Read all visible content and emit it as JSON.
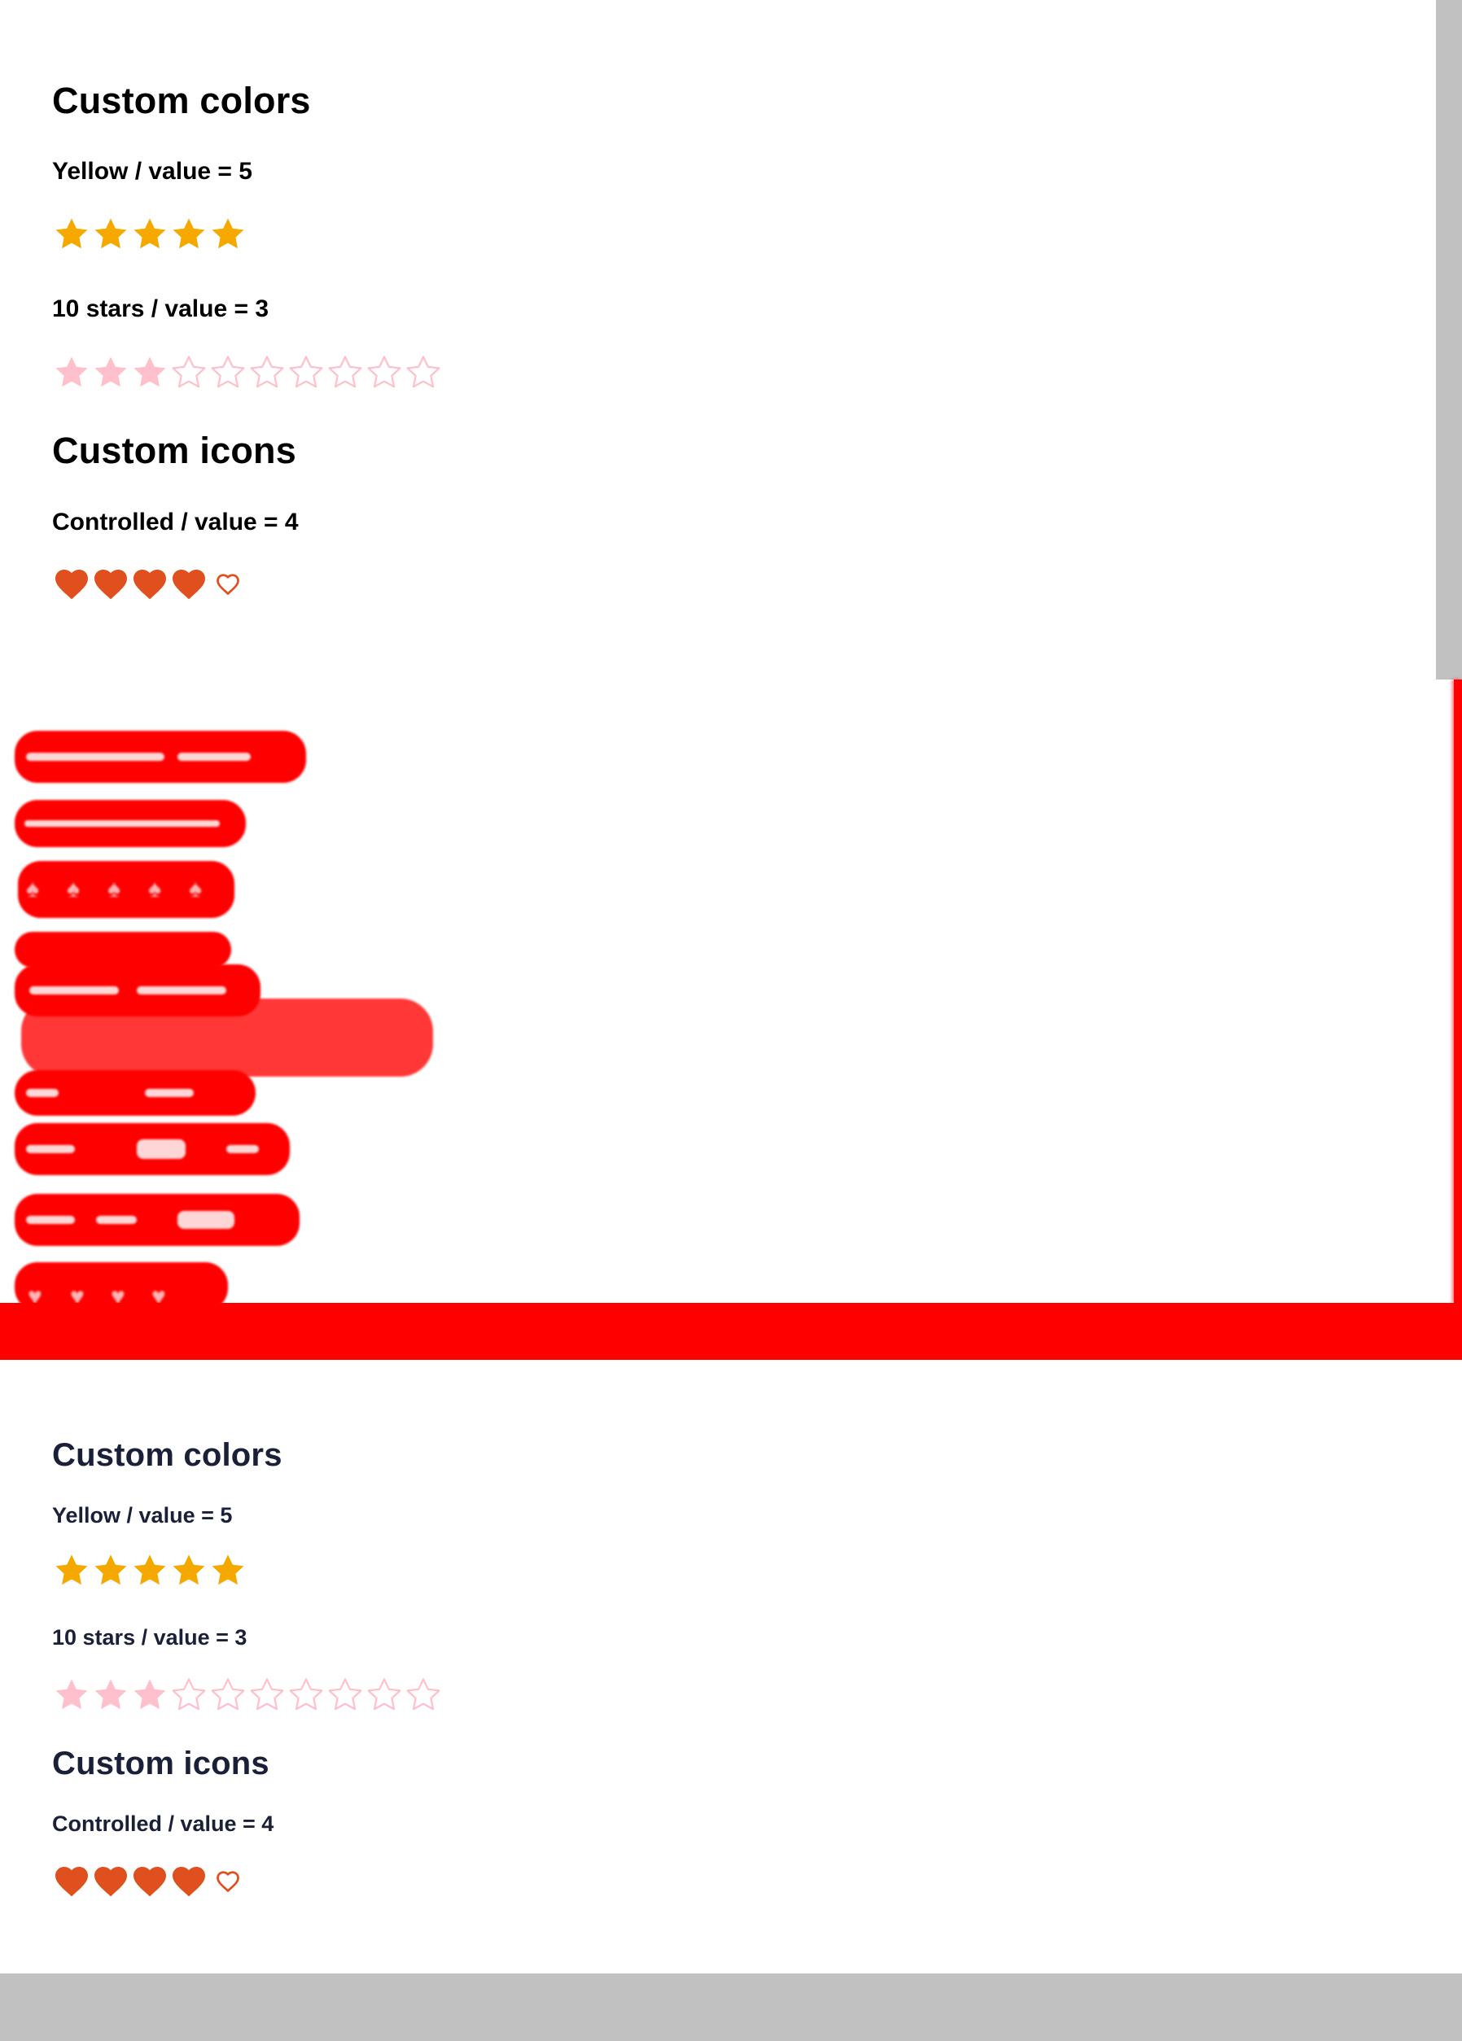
{
  "colors": {
    "yellow": "#f5a800",
    "pink": "#ffc0cb",
    "heart": "#e0501e",
    "diff_red": "#ff0000",
    "scrollbar": "#c1c1c1",
    "heading_top": "#000000",
    "heading_bottom": "#1a2038"
  },
  "icons": {
    "star": "star-icon",
    "star_outline": "star-outline-icon",
    "heart": "heart-icon",
    "heart_outline": "heart-outline-icon"
  },
  "panel_top": {
    "section_custom_colors": {
      "title": "Custom colors",
      "yellow": {
        "label": "Yellow / value = 5",
        "value": 5,
        "max": 5
      },
      "ten_stars": {
        "label": "10 stars / value = 3",
        "value": 3,
        "max": 10
      }
    },
    "section_custom_icons": {
      "title": "Custom icons",
      "controlled": {
        "label": "Controlled / value = 4",
        "value": 4,
        "max": 5
      }
    }
  },
  "panel_bottom": {
    "section_custom_colors": {
      "title": "Custom colors",
      "yellow": {
        "label": "Yellow / value = 5",
        "value": 5,
        "max": 5
      },
      "ten_stars": {
        "label": "10 stars / value = 3",
        "value": 3,
        "max": 10
      }
    },
    "section_custom_icons": {
      "title": "Custom icons",
      "controlled": {
        "label": "Controlled / value = 4",
        "value": 4,
        "max": 5
      }
    }
  }
}
